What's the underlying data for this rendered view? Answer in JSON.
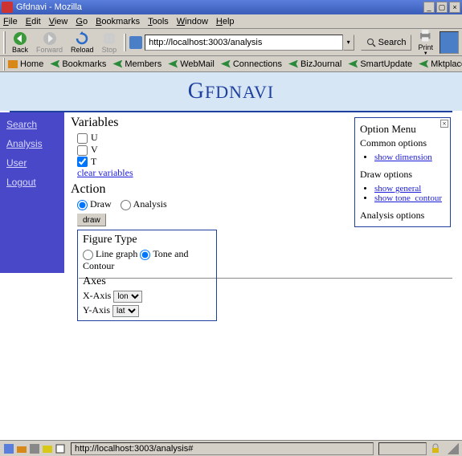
{
  "window": {
    "title": "Gfdnavi - Mozilla"
  },
  "menubar": [
    "File",
    "Edit",
    "View",
    "Go",
    "Bookmarks",
    "Tools",
    "Window",
    "Help"
  ],
  "toolbar": {
    "back": "Back",
    "forward": "Forward",
    "reload": "Reload",
    "stop": "Stop",
    "url": "http://localhost:3003/analysis",
    "search": "Search",
    "print": "Print"
  },
  "bookmarkbar": [
    "Home",
    "Bookmarks",
    "Members",
    "WebMail",
    "Connections",
    "BizJournal",
    "SmartUpdate",
    "Mktplace"
  ],
  "app": {
    "title": "Gfdnavi"
  },
  "sidebar": [
    "Search",
    "Analysis",
    "User",
    "Logout"
  ],
  "variables": {
    "heading": "Variables",
    "items": [
      {
        "label": "U",
        "checked": false
      },
      {
        "label": "V",
        "checked": false
      },
      {
        "label": "T",
        "checked": true
      }
    ],
    "clear": "clear variables"
  },
  "action": {
    "heading": "Action",
    "options": [
      {
        "label": "Draw",
        "checked": true
      },
      {
        "label": "Analysis",
        "checked": false
      }
    ],
    "draw_button": "draw"
  },
  "figure": {
    "heading": "Figure Type",
    "options": [
      {
        "label": "Line graph",
        "checked": false
      },
      {
        "label": "Tone and Contour",
        "checked": true
      }
    ],
    "axes_heading": "Axes",
    "xaxis_label": "X-Axis",
    "xaxis_value": "lon",
    "yaxis_label": "Y-Axis",
    "yaxis_value": "lat"
  },
  "option_menu": {
    "heading": "Option Menu",
    "common_label": "Common options",
    "common_links": [
      "show dimension"
    ],
    "draw_label": "Draw options",
    "draw_links": [
      "show general",
      "show tone_contour"
    ],
    "analysis_label": "Analysis options"
  },
  "statusbar": {
    "text": "http://localhost:3003/analysis#"
  }
}
